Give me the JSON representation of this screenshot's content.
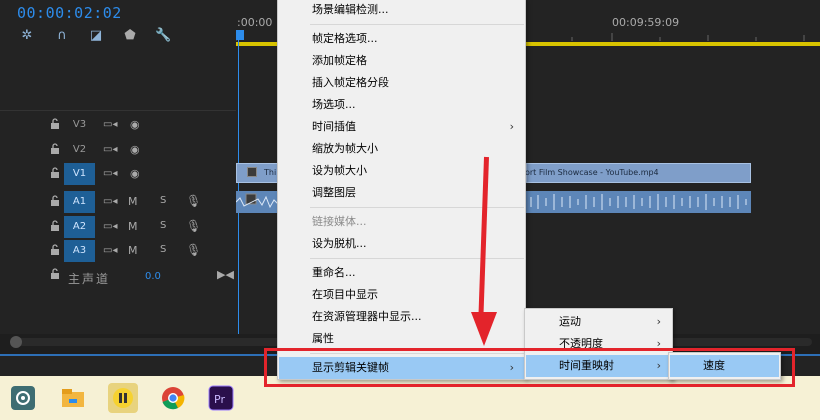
{
  "timeline": {
    "timecode": "00:00:02:02",
    "ruler": {
      "start_label": ":00:00",
      "end_label": "00:09:59:09"
    },
    "tracks": [
      {
        "name": "V3"
      },
      {
        "name": "V2"
      },
      {
        "name": "V1"
      },
      {
        "name": "A1",
        "m": "M",
        "s": "S"
      },
      {
        "name": "A2",
        "m": "M",
        "s": "S"
      },
      {
        "name": "A3",
        "m": "M",
        "s": "S"
      }
    ],
    "master": {
      "label": "主声道",
      "value": "0.0"
    },
    "clips": {
      "video_left": "Thi",
      "video_right": "ort Film Showcase - YouTube.mp4"
    }
  },
  "context_menu": {
    "items": [
      {
        "label": "场景编辑检测..."
      },
      {
        "label": "帧定格选项..."
      },
      {
        "label": "添加帧定格"
      },
      {
        "label": "插入帧定格分段"
      },
      {
        "label": "场选项..."
      },
      {
        "label": "时间插值",
        "submenu": true
      },
      {
        "label": "缩放为帧大小"
      },
      {
        "label": "设为帧大小"
      },
      {
        "label": "调整图层"
      },
      {
        "label": "链接媒体...",
        "disabled": true
      },
      {
        "label": "设为脱机..."
      },
      {
        "label": "重命名..."
      },
      {
        "label": "在项目中显示"
      },
      {
        "label": "在资源管理器中显示..."
      },
      {
        "label": "属性"
      },
      {
        "label": "显示剪辑关键帧",
        "submenu": true,
        "highlighted": true
      }
    ]
  },
  "submenu_keyframes": {
    "items": [
      {
        "label": "运动",
        "submenu": true
      },
      {
        "label": "不透明度",
        "submenu": true
      },
      {
        "label": "时间重映射",
        "submenu": true,
        "highlighted": true
      }
    ]
  },
  "submenu_timeremap": {
    "items": [
      {
        "label": "速度",
        "highlighted": true
      }
    ]
  },
  "colors": {
    "accent_blue": "#2d8ceb",
    "menu_highlight": "#99c9f4",
    "annotation_red": "#e3242b",
    "work_area_yellow": "#d8c300"
  },
  "taskbar": {
    "apps": [
      {
        "icon": "settings-circle-icon"
      },
      {
        "icon": "file-explorer-icon"
      },
      {
        "icon": "pause-app-icon",
        "active": true
      },
      {
        "icon": "chrome-icon"
      },
      {
        "icon": "premiere-pro-icon",
        "text": "Pr"
      }
    ]
  }
}
